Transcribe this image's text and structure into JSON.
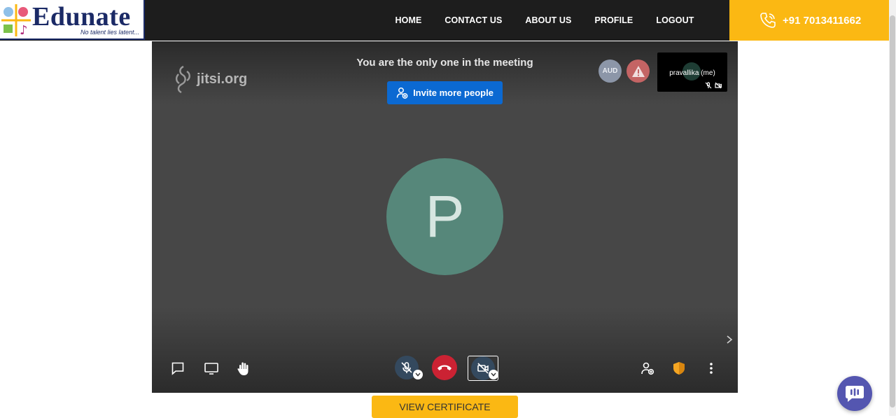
{
  "header": {
    "logo_text": "Edunate",
    "logo_tagline": "No talent lies latent...",
    "nav": [
      "HOME",
      "CONTACT US",
      "ABOUT US",
      "PROFILE",
      "LOGOUT"
    ],
    "phone": "+91 7013411662"
  },
  "meeting": {
    "brand": "jitsi.org",
    "notice": "You are the only one in the meeting",
    "invite_label": "Invite more people",
    "aud_badge": "AUD",
    "self_name": "pravallika (me)",
    "avatar_initial": "P"
  },
  "footer": {
    "certificate_label": "VIEW CERTIFICATE"
  },
  "colors": {
    "accent": "#fbb813",
    "invite": "#0b69d2",
    "hangup": "#cb2233",
    "avatar": "#56877a",
    "chat": "#5456b0"
  }
}
